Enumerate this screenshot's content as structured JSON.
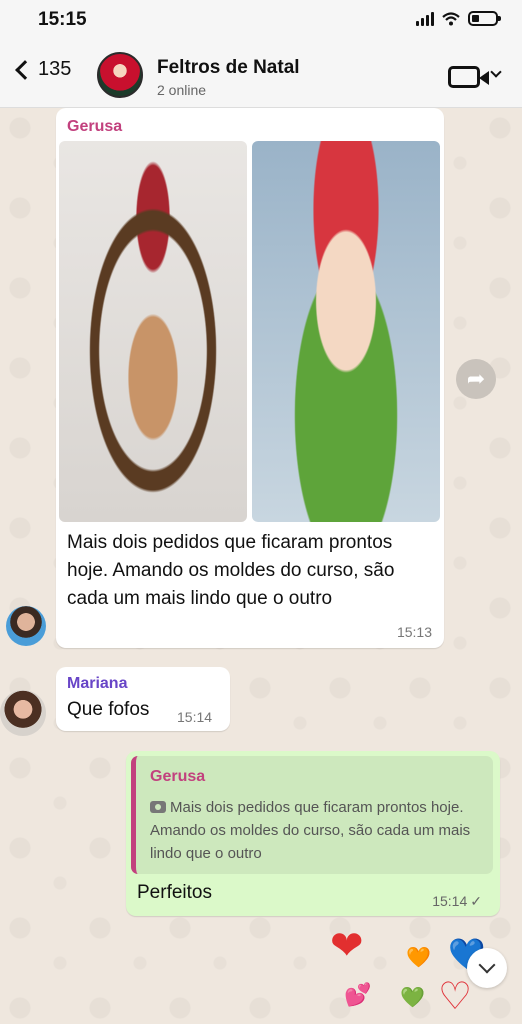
{
  "status_bar": {
    "time": "15:15"
  },
  "header": {
    "back_count": "135",
    "group_name": "Feltros de Natal",
    "subtitle": "2 online"
  },
  "messages": [
    {
      "sender": "Gerusa",
      "text": "Mais dois pedidos que ficaram prontos hoje. Amando os moldes do curso, são cada um mais lindo que o outro",
      "time": "15:13"
    },
    {
      "sender": "Mariana",
      "text": "Que fofos",
      "time": "15:14"
    },
    {
      "quote_sender": "Gerusa",
      "quote_text": "Mais dois pedidos que ficaram prontos hoje. Amando os moldes do curso, são cada um mais lindo que o outro",
      "text": "Perfeitos",
      "time": "15:14",
      "status_icon": "single-check"
    }
  ],
  "reactions": [
    "❤",
    "🧡",
    "💙",
    "💕",
    "💚",
    "♡"
  ],
  "colors": {
    "gerusa_name": "#c2417e",
    "mariana_name": "#6845c7",
    "outgoing_bubble": "#dbf9c9",
    "chat_background": "#efe7de"
  }
}
